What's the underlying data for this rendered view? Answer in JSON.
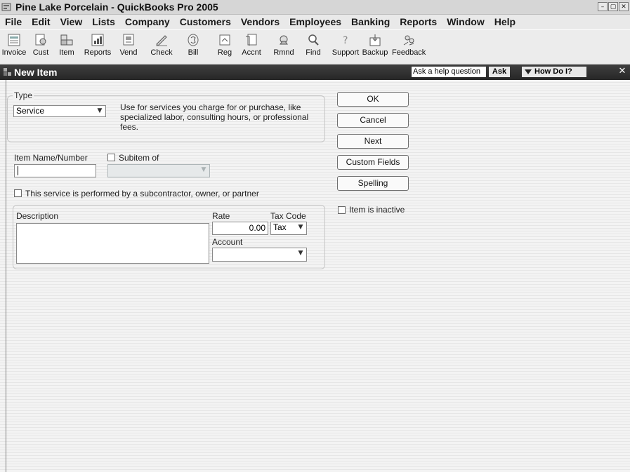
{
  "app": {
    "title": "Pine Lake Porcelain - QuickBooks Pro 2005"
  },
  "window_controls": [
    "–",
    "▢",
    "✕"
  ],
  "menu": [
    "File",
    "Edit",
    "View",
    "Lists",
    "Company",
    "Customers",
    "Vendors",
    "Employees",
    "Banking",
    "Reports",
    "Window",
    "Help"
  ],
  "toolbar": [
    {
      "label": "Invoice",
      "icon": "invoice-icon"
    },
    {
      "label": "Cust",
      "icon": "customer-icon"
    },
    {
      "label": "Item",
      "icon": "item-icon"
    },
    {
      "label": "Reports",
      "icon": "reports-icon"
    },
    {
      "label": "Vend",
      "icon": "vendor-icon"
    },
    {
      "label": "Check",
      "icon": "check-icon"
    },
    {
      "label": "Bill",
      "icon": "bill-icon"
    },
    {
      "label": "Reg",
      "icon": "register-icon"
    },
    {
      "label": "Accnt",
      "icon": "account-icon"
    },
    {
      "label": "Rmnd",
      "icon": "reminder-icon"
    },
    {
      "label": "Find",
      "icon": "find-icon"
    },
    {
      "label": "Support",
      "icon": "support-icon"
    },
    {
      "label": "Backup",
      "icon": "backup-icon"
    },
    {
      "label": "Feedback",
      "icon": "feedback-icon"
    }
  ],
  "window": {
    "title": "New Item",
    "help_question": "Ask a help question",
    "ask_label": "Ask",
    "how_do_i": "How Do I?",
    "close": "✕"
  },
  "form": {
    "type_legend": "Type",
    "type_value": "Service",
    "type_description": "Use for services you charge for or purchase, like specialized labor, consulting hours, or professional fees.",
    "item_name_label": "Item Name/Number",
    "item_name_value": "",
    "subitem_label": "Subitem of",
    "subitem_value": "",
    "subcontractor_label": "This service is performed by a subcontractor, owner, or partner",
    "description_label": "Description",
    "description_value": "",
    "rate_label": "Rate",
    "rate_value": "0.00",
    "tax_code_label": "Tax Code",
    "tax_code_value": "Tax",
    "account_label": "Account",
    "account_value": "",
    "inactive_label": "Item is inactive"
  },
  "buttons": {
    "ok": "OK",
    "cancel": "Cancel",
    "next": "Next",
    "custom_fields": "Custom Fields",
    "spelling": "Spelling"
  },
  "colors": {
    "header_bg": "#2f2f2f",
    "main_bg": "#f4f4f4",
    "disabled_field": "#e6e9ea"
  }
}
